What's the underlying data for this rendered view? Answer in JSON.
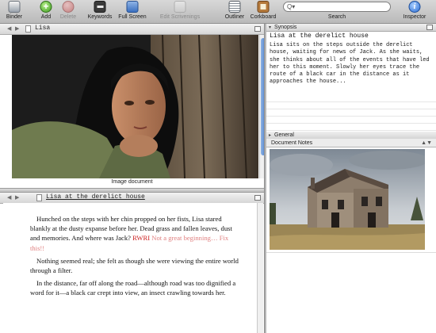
{
  "toolbar": {
    "binder": "Binder",
    "add": "Add",
    "delete": "Delete",
    "keywords": "Keywords",
    "full_screen": "Full Screen",
    "edit_scrivenings": "Edit Scrivenings",
    "outliner": "Outliner",
    "corkboard": "Corkboard",
    "search": "Search",
    "search_icon": "Q▾",
    "inspector": "Inspector",
    "inspector_glyph": "i",
    "add_glyph": "+"
  },
  "top_editor": {
    "nav_back": "◀",
    "nav_forward": "▶",
    "title": "Lisa",
    "caption": "Image document"
  },
  "bottom_editor": {
    "nav_back": "◀",
    "nav_forward": "▶",
    "title": "Lisa at the derelict house",
    "paragraphs": {
      "p1_main": "Hunched on the steps with her chin propped on her fists, Lisa stared blankly at the dusty expanse before her. Dead grass and fallen leaves, dust and memories. And where was Jack?",
      "p1_tag": "RWRI",
      "p1_note": "Not a great beginning… Fix this!!",
      "p2": "Nothing seemed real; she felt as though she were viewing the entire world through a filter.",
      "p3": "In the distance, far off along the road—although road was too dignified a word for it—a black car crept into view, an insect crawling towards her."
    }
  },
  "inspector": {
    "synopsis_label": "Synopsis",
    "synopsis_title": "Lisa at the derelict house",
    "synopsis_text": "Lisa sits on the steps outside the derelict house, waiting for news of Jack. As she waits, she thinks about all of the events that have led her to this moment. Slowly her eyes trace the route of a black car in the distance as it approaches the house...",
    "general_label": "General",
    "notes_label": "Document Notes",
    "notes_arrows": "▲▼"
  },
  "colors": {
    "scroll_accent": "#4b80cf",
    "note_text": "#e08080",
    "tag_text": "#cc2222"
  }
}
